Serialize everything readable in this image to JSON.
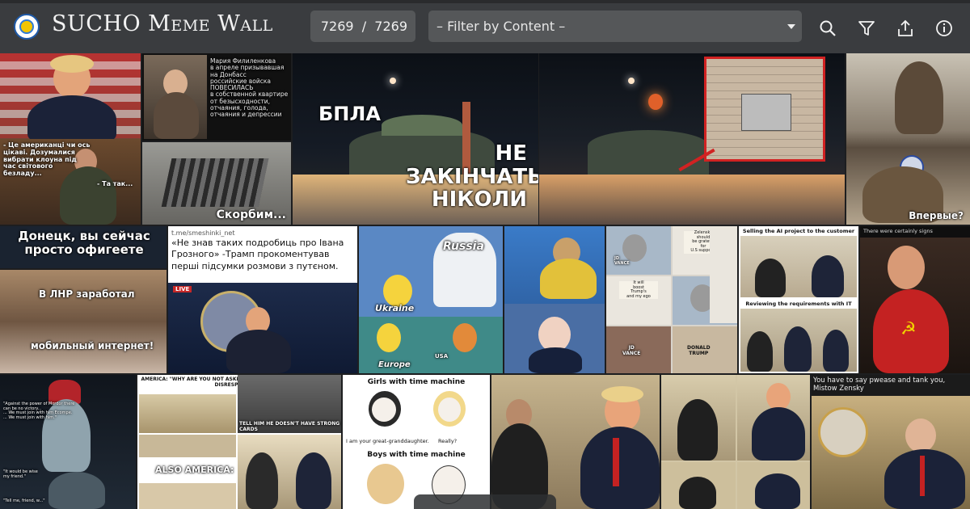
{
  "app": {
    "title": "SUCHO Meme Wall",
    "counter": "7269  /  7269",
    "filter_placeholder": "– Filter by Content –"
  },
  "toolbar": {
    "icons": [
      "search-icon",
      "filter-icon",
      "share-icon",
      "info-icon"
    ]
  },
  "tiles": {
    "t1_quote": "- Це американці чи ось\nцікаві. Дозумалися\nвибрати клоуна під\nчас світового\nбезладу...",
    "t1_reply": "- Та так...",
    "t2_text": "Мария Филиленкова\nв апреле призывавшая\nна Донбасс\nроссийские войска\nПОВЕСИЛАСЬ\nв собственной квартире\nот безысходности,\nотчаяния, голода,\nотчаяния и депрессии",
    "t3_caption": "Скорбим...",
    "t4_left": "БПЛА",
    "t4_right": "НЕ\nЗАКІНЧАТЬСЯ\nНІКОЛИ",
    "t6_caption": "Впервые?",
    "t7_title": "Донецк, вы сейчас\nпросто офигеете",
    "t8_cap1": "В ЛНР заработал",
    "t8_cap2": "мобильный интернет!",
    "t9_handle": "t.me/smeshinki_net",
    "t9_text": "«Не знав таких подробиць про Івана Грозного» -Трамп прокоментував перші підсумки розмови з путєном.",
    "t9_badge": "LIVE",
    "t10_russia": "Russia",
    "t10_ukraine": "Ukraine",
    "t10_europe": "Europe",
    "t10_usa": "USA",
    "gru_1": "JD\nVANCE",
    "gru_2": "Zelensky\nshould\nbe grateful\nfor\nU.S support!",
    "gru_3": "Thanking\nTrump makes\nBiden\nlook weak and\nTrump strong",
    "gru_4": "It will\nboost\nTrump's\nand my ego",
    "gru_5": "Zelensky:\nThank\nyou,\nAmerican\ntaxpayers!",
    "gru_6": "JD\nVANCE",
    "gru_7": "DONALD\nTRUMP",
    "ai_top": "Selling the AI project to the customer",
    "ai_bottom": "Reviewing the requirements with IT",
    "signs_caption": "There were certainly signs",
    "gandalf_1": "\"Against the power of Mordor there\ncan be no victory...\n... We must join with him Ecompe.\n... We must join with him.\"",
    "gandalf_2": "\"It would be wise\nmy friend.\"",
    "gandalf_3": "\"Tell me, friend, w...\"",
    "america_1": "AMERICA:\n\"WHY ARE YOU NOT ASKING ABOUT US?\nWHY ARE YOU BEING DISRESPECTFUL?\"",
    "america_2": "TELL HIM HE DOESN'T HAVE STRONG CARDS",
    "america_3": "ALSO AMERICA:",
    "time_title1": "Girls with time machine",
    "time_girl": "I am your great-granddaughter.",
    "time_really": "Really?",
    "time_title2": "Boys with time machine",
    "mistow_caption": "You have to say pwease and tank you, Mistow Zensky"
  }
}
